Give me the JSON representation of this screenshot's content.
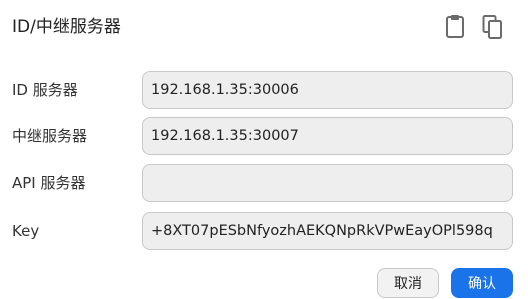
{
  "dialog": {
    "title": "ID/中继服务器"
  },
  "header_icons": [
    {
      "name": "clipboard-paste-icon"
    },
    {
      "name": "copy-icon"
    }
  ],
  "fields": {
    "id_server": {
      "label": "ID 服务器",
      "value": "192.168.1.35:30006"
    },
    "relay_server": {
      "label": "中继服务器",
      "value": "192.168.1.35:30007"
    },
    "api_server": {
      "label": "API 服务器",
      "value": ""
    },
    "key": {
      "label": "Key",
      "value": "+8XT07pESbNfyozhAEKQNpRkVPwEayOPl598q"
    }
  },
  "buttons": {
    "cancel": "取消",
    "ok": "确认"
  },
  "colors": {
    "accent": "#1a73e8",
    "field_bg": "#eeeeee",
    "field_border": "#c8c8c8"
  }
}
